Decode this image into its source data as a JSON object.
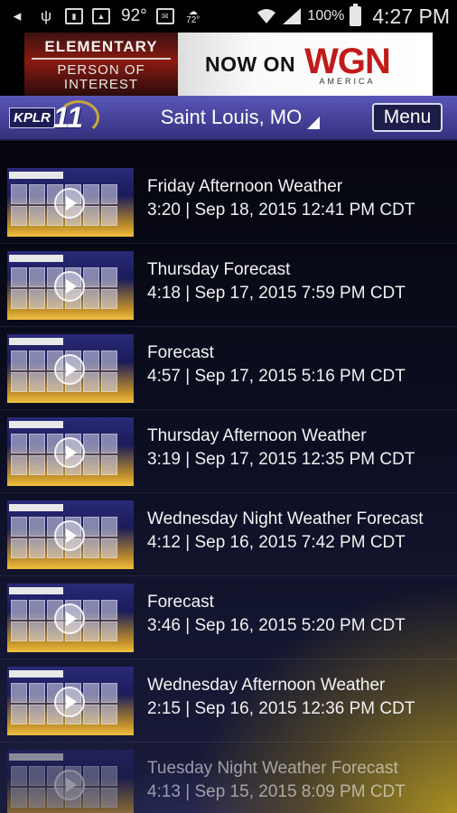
{
  "status_bar": {
    "temp": "92°",
    "weather_temp": "72°",
    "battery": "100%",
    "time": "4:27 PM"
  },
  "ad": {
    "show_line1": "ELEMENTARY",
    "show_line2": "PERSON OF INTEREST",
    "now_on": "NOW ON",
    "brand": "WGN",
    "brand_sub": "AMERICA"
  },
  "header": {
    "logo_text": "KPLR",
    "logo_number": "11",
    "location": "Saint Louis, MO",
    "menu_label": "Menu"
  },
  "videos": [
    {
      "title": "Friday Afternoon Weather",
      "meta": "3:20 | Sep 18, 2015 12:41 PM CDT"
    },
    {
      "title": "Thursday Forecast",
      "meta": "4:18 | Sep 17, 2015 7:59 PM CDT"
    },
    {
      "title": "Forecast",
      "meta": "4:57 | Sep 17, 2015 5:16 PM CDT"
    },
    {
      "title": "Thursday Afternoon Weather",
      "meta": "3:19 | Sep 17, 2015 12:35 PM CDT"
    },
    {
      "title": "Wednesday Night Weather Forecast",
      "meta": "4:12 | Sep 16, 2015 7:42 PM CDT"
    },
    {
      "title": "Forecast",
      "meta": "3:46 | Sep 16, 2015 5:20 PM CDT"
    },
    {
      "title": "Wednesday Afternoon Weather",
      "meta": "2:15 | Sep 16, 2015 12:36 PM CDT"
    },
    {
      "title": "Tuesday Night Weather Forecast",
      "meta": "4:13 | Sep 15, 2015 8:09 PM CDT"
    }
  ],
  "colors": {
    "header_top": "#5a56b8",
    "header_bottom": "#34317e",
    "accent_gold": "#c9a83a",
    "brand_red": "#c11a1a"
  }
}
